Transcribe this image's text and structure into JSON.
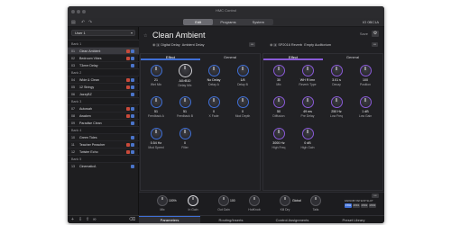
{
  "window": {
    "title": "HMC Control"
  },
  "toolbar": {
    "modes": [
      {
        "label": "Edit",
        "active": true
      },
      {
        "label": "Programs",
        "active": false
      },
      {
        "label": "System",
        "active": false
      }
    ],
    "midi_indicator": "IO 0BC1A",
    "undo_icon": "undo-icon",
    "redo_icon": "redo-icon",
    "sidebar_toggle_icon": "sidebar-icon"
  },
  "sidebar": {
    "user_select": "User 1",
    "banks": [
      {
        "name": "Bank 1",
        "presets": [
          {
            "num": "01",
            "name": "Clean Ambient",
            "selected": true,
            "flags": 2
          },
          {
            "num": "02",
            "name": "Bedroom Vibes",
            "selected": false,
            "flags": 2
          },
          {
            "num": "03",
            "name": "T3mre Delay",
            "selected": false,
            "flags": 1
          }
        ]
      },
      {
        "name": "Bank 2",
        "presets": [
          {
            "num": "04",
            "name": "Wide & Clean",
            "selected": false,
            "flags": 2
          },
          {
            "num": "05",
            "name": "12 Stringy",
            "selected": false,
            "flags": 2
          },
          {
            "num": "06",
            "name": "JazzyBZ",
            "selected": false,
            "flags": 1
          }
        ]
      },
      {
        "name": "Bank 3",
        "presets": [
          {
            "num": "07",
            "name": "Autowah",
            "selected": false,
            "flags": 2
          },
          {
            "num": "08",
            "name": "Awaken",
            "selected": false,
            "flags": 2
          },
          {
            "num": "09",
            "name": "Paradise Clean",
            "selected": false,
            "flags": 1
          }
        ]
      },
      {
        "name": "Bank 4",
        "presets": [
          {
            "num": "10",
            "name": "Green Tides",
            "selected": false,
            "flags": 1
          },
          {
            "num": "11",
            "name": "Teacher Preacher",
            "selected": false,
            "flags": 2
          },
          {
            "num": "12",
            "name": "Twister Echo",
            "selected": false,
            "flags": 2
          }
        ]
      },
      {
        "name": "Bank 5",
        "presets": [
          {
            "num": "13",
            "name": "CinematicA",
            "selected": false,
            "flags": 1
          }
        ]
      }
    ],
    "bottom_icons": [
      "add-icon",
      "import-icon",
      "export-icon",
      "link-icon",
      "trash-icon"
    ]
  },
  "preset": {
    "title": "Clean Ambient",
    "save_label": "Save",
    "slot_a": {
      "num": "1",
      "label": "Digital Delay",
      "sub": "Ambient Delay"
    },
    "slot_b": {
      "num": "2",
      "label": "SP2016 Reverb",
      "sub": "Empty Auditorium"
    }
  },
  "left_panel": {
    "tabs": [
      {
        "label": "Effect",
        "active": true
      },
      {
        "label": "General",
        "active": false
      }
    ],
    "knobs": [
      {
        "value": "21",
        "label": "Wet Mix"
      },
      {
        "value": "A0>B10",
        "label": "Delay Mix"
      },
      {
        "value": "No Delay",
        "label": "Delay A"
      },
      {
        "value": "1/8",
        "label": "Delay B"
      },
      {
        "value": "51",
        "label": "Feedback A"
      },
      {
        "value": "51",
        "label": "Feedback B"
      },
      {
        "value": "0",
        "label": "X Fade"
      },
      {
        "value": "0",
        "label": "Mod Depth"
      },
      {
        "value": "0.54 Hz",
        "label": "Mod Speed"
      },
      {
        "value": "0",
        "label": "Filter"
      }
    ]
  },
  "right_panel": {
    "tabs": [
      {
        "label": "Effect",
        "active": true
      },
      {
        "label": "General",
        "active": false
      }
    ],
    "knobs": [
      {
        "value": "30",
        "label": "Mix"
      },
      {
        "value": "WH R Imn",
        "label": "Reverb Type"
      },
      {
        "value": "3.01 s",
        "label": "Decay"
      },
      {
        "value": "100",
        "label": "Position"
      },
      {
        "value": "50",
        "label": "Diffusion"
      },
      {
        "value": "49 ms",
        "label": "Pre Delay"
      },
      {
        "value": "250 Hz",
        "label": "Low Freq"
      },
      {
        "value": "1 dB",
        "label": "Low Gain"
      },
      {
        "value": "3000 Hz",
        "label": "High Freq"
      },
      {
        "value": "0 dB",
        "label": "High Gain"
      }
    ]
  },
  "mixer": {
    "knobs": [
      {
        "value": "",
        "label": "Mix"
      },
      {
        "value": "100%",
        "label": "In Gain"
      },
      {
        "value": "",
        "label": "Out Gain"
      },
      {
        "value": "100",
        "label": "HotKnob"
      },
      {
        "value": "",
        "label": "Kill Dry"
      },
      {
        "value": "Global",
        "label": "Tails"
      }
    ],
    "footswitch_label": "FAKNOB TAP EXP SLOT",
    "footswitch_buttons": [
      {
        "label": "FSW",
        "active": true
      },
      {
        "label": "MID1",
        "active": false
      },
      {
        "label": "MID2",
        "active": false
      },
      {
        "label": "MID3",
        "active": false
      }
    ]
  },
  "bottom_tabs": [
    {
      "label": "Parameters",
      "active": true
    },
    {
      "label": "Routing/Inserts",
      "active": false
    },
    {
      "label": "Control Assignments",
      "active": false
    },
    {
      "label": "Preset Library",
      "active": false
    }
  ],
  "colors": {
    "effect_a_accent": "#3f6fd6",
    "effect_b_accent": "#8a5ad8",
    "background": "#202023"
  }
}
